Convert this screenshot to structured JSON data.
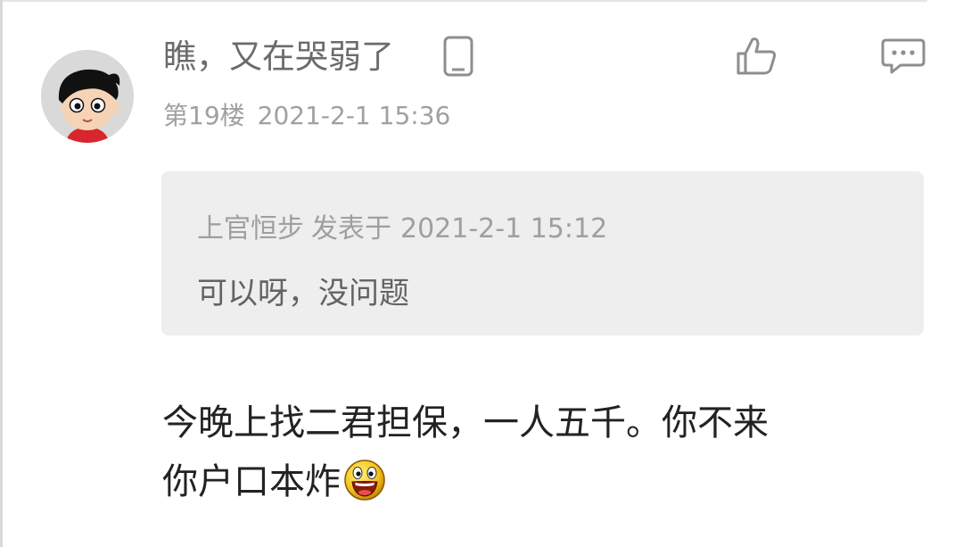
{
  "post": {
    "username": "瞧，又在哭弱了",
    "floor": "第19楼",
    "timestamp": "2021-2-1 15:36",
    "quote": {
      "author": "上官恒步",
      "posted_at_label": "发表于",
      "posted_at": "2021-2-1 15:12",
      "text": "可以呀，没问题"
    },
    "body_lines": [
      "今晚上找二君担保，一人五千。你不来",
      "你户口本炸"
    ],
    "icons": {
      "device": "phone-icon",
      "like": "thumbs-up-icon",
      "comment": "comment-icon",
      "emoji": "laughing-emoji-icon"
    }
  },
  "colors": {
    "username": "#6b6b6b",
    "meta": "#a0a0a0",
    "quote_bg": "#eeeeee",
    "body_text": "#222222"
  }
}
